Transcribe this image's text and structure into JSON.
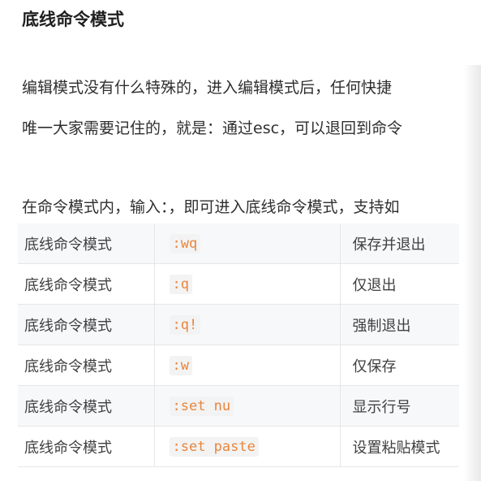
{
  "section": {
    "title": "底线命令模式",
    "paragraphs": [
      "编辑模式没有什么特殊的，进入编辑模式后，任何快捷",
      "唯一大家需要记住的，就是：通过esc，可以退回到命令",
      "在命令模式内，输入：，即可进入底线命令模式，支持如"
    ]
  },
  "table": {
    "rows": [
      {
        "mode": "底线命令模式",
        "command": ":wq",
        "description": "保存并退出"
      },
      {
        "mode": "底线命令模式",
        "command": ":q",
        "description": "仅退出"
      },
      {
        "mode": "底线命令模式",
        "command": ":q!",
        "description": "强制退出"
      },
      {
        "mode": "底线命令模式",
        "command": ":w",
        "description": "仅保存"
      },
      {
        "mode": "底线命令模式",
        "command": ":set nu",
        "description": "显示行号"
      },
      {
        "mode": "底线命令模式",
        "command": ":set paste",
        "description": "设置粘贴模式"
      }
    ]
  },
  "colors": {
    "code_text": "#e9853c",
    "row_stripe": "#f6f8fa"
  }
}
